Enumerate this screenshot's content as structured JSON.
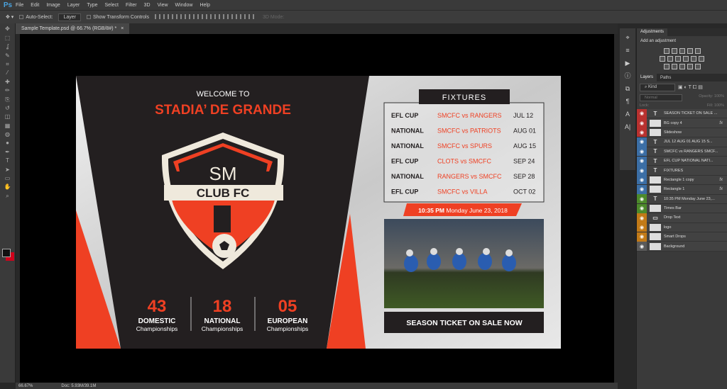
{
  "app": {
    "logo": "Ps",
    "menus": [
      "File",
      "Edit",
      "Image",
      "Layer",
      "Type",
      "Select",
      "Filter",
      "3D",
      "View",
      "Window",
      "Help"
    ]
  },
  "options": {
    "auto_select": "Auto-Select:",
    "auto_select_value": "Layer",
    "show_transform": "Show Transform Controls",
    "mode3d": "3D Mode:"
  },
  "document": {
    "tab_title": "Sample Template.psd @ 66.7% (RGB/8#) *",
    "close": "×"
  },
  "status": {
    "zoom": "66.67%",
    "doc": "Doc: 5.93M/39.1M"
  },
  "artwork": {
    "welcome": "WELCOME TO",
    "stadium": "STADIA’ DE GRANDE",
    "logo_text": {
      "monogram": "SM",
      "banner": "CLUB FC"
    },
    "stats": [
      {
        "num": "43",
        "title": "DOMESTIC",
        "sub": "Championships"
      },
      {
        "num": "18",
        "title": "NATIONAL",
        "sub": "Championships"
      },
      {
        "num": "05",
        "title": "EUROPEAN",
        "sub": "Championships"
      }
    ],
    "fixtures_title": "FIXTURES",
    "fixtures": [
      {
        "comp": "EFL CUP",
        "match": "SMCFC vs RANGERS",
        "date": "JUL 12"
      },
      {
        "comp": "NATIONAL",
        "match": "SMCFC vs PATRIOTS",
        "date": "AUG 01"
      },
      {
        "comp": "NATIONAL",
        "match": "SMCFC vs SPURS",
        "date": "AUG 15"
      },
      {
        "comp": "EFL CUP",
        "match": "CLOTS vs SMCFC",
        "date": "SEP 24"
      },
      {
        "comp": "NATIONAL",
        "match": "RANGERS vs SMCFC",
        "date": "SEP 28"
      },
      {
        "comp": "EFL CUP",
        "match": "SMCFC vs VILLA",
        "date": "OCT 02"
      }
    ],
    "time": "10:35 PM",
    "date": "Monday June 23, 2018",
    "cta": "SEASON TICKET ON SALE NOW",
    "colors": {
      "accent": "#ef4023",
      "dark": "#231f20",
      "light": "#e6e6e6"
    }
  },
  "adjustments": {
    "tab": "Adjustments",
    "hint": "Add an adjustment"
  },
  "layers_panel": {
    "tabs": [
      "Layers",
      "Paths"
    ],
    "filter": "Kind",
    "blend": "Normal",
    "opacity_label": "Opacity:",
    "opacity": "100%",
    "lock_label": "Lock:",
    "fill_label": "Fill:",
    "fill": "100%",
    "layers": [
      {
        "name": "SEASON TICKET ON SALE ...",
        "type": "text",
        "color": "#b8312f",
        "fx": false
      },
      {
        "name": "BG copy 4",
        "type": "pixel",
        "color": "#b8312f",
        "fx": true
      },
      {
        "name": "Slideshow",
        "type": "smart",
        "color": "#b8312f",
        "fx": false
      },
      {
        "name": "JUL 12  AUG 01  AUG 15  S...",
        "type": "text",
        "color": "#3b6ea5",
        "fx": false
      },
      {
        "name": "SMCFC vs RANGERS  SMCF...",
        "type": "text",
        "color": "#3b6ea5",
        "fx": false
      },
      {
        "name": "EFL CUP  NATIONAL  NATI...",
        "type": "text",
        "color": "#3b6ea5",
        "fx": false
      },
      {
        "name": "FIXTURES",
        "type": "text",
        "color": "#3b6ea5",
        "fx": false
      },
      {
        "name": "Rectangle 1 copy",
        "type": "shape",
        "color": "#3b6ea5",
        "fx": true
      },
      {
        "name": "Rectangle 1",
        "type": "shape",
        "color": "#3b6ea5",
        "fx": true
      },
      {
        "name": "10:35 PM Monday June 23,...",
        "type": "text",
        "color": "#4c8a2b",
        "fx": false
      },
      {
        "name": "Times Bar",
        "type": "pixel",
        "color": "#4c8a2b",
        "fx": false
      },
      {
        "name": "Drop Text",
        "type": "group",
        "color": "#c27a17",
        "fx": false
      },
      {
        "name": "logo",
        "type": "smart",
        "color": "#c27a17",
        "fx": false
      },
      {
        "name": "Smart Drops",
        "type": "smart",
        "color": "#c27a17",
        "fx": false
      },
      {
        "name": "Background",
        "type": "pixel",
        "color": "#5a5a5a",
        "fx": false
      }
    ]
  }
}
